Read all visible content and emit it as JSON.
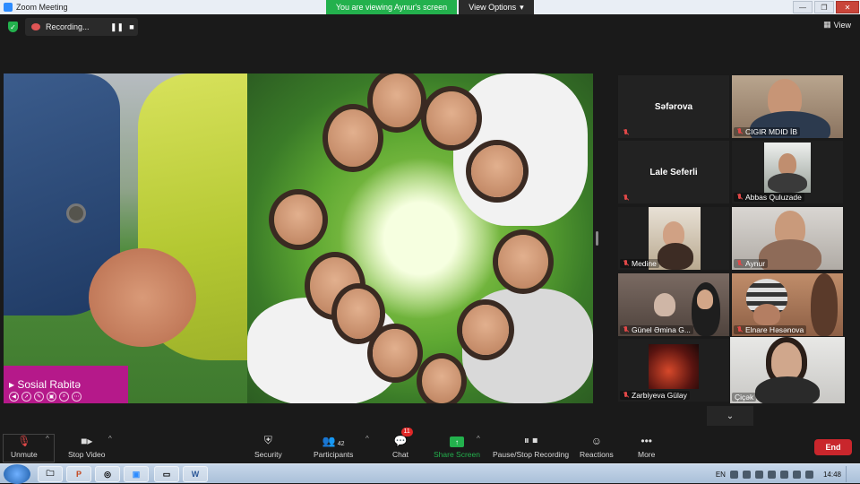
{
  "window": {
    "title": "Zoom Meeting"
  },
  "banner": {
    "viewing_text": "You are viewing Aynur's screen",
    "view_options": "View Options"
  },
  "recording": {
    "label": "Recording..."
  },
  "view_button": {
    "label": "View"
  },
  "slide": {
    "title": "Sosial Rabitə"
  },
  "gallery": {
    "tiles": [
      {
        "name": "Səfərova",
        "video": false,
        "muted": false
      },
      {
        "name": "CIGIR MDID İB",
        "video": true,
        "muted": true
      },
      {
        "name": "Lale Seferli",
        "video": false,
        "muted": false
      },
      {
        "name": "Abbas Quluzade",
        "video": true,
        "muted": true
      },
      {
        "name": "Medine",
        "video": true,
        "muted": true
      },
      {
        "name": "Aynur",
        "video": true,
        "muted": true
      },
      {
        "name": "Günel Əmina G...",
        "video": true,
        "muted": true
      },
      {
        "name": "Elnare Həsənova",
        "video": true,
        "muted": true
      },
      {
        "name": "Zarbiyeva Gülay",
        "video": true,
        "muted": true
      },
      {
        "name": "Çiçək",
        "video": true,
        "muted": false
      }
    ]
  },
  "toolbar": {
    "unmute": "Unmute",
    "stop_video": "Stop Video",
    "security": "Security",
    "participants": "Participants",
    "participants_count": "42",
    "chat": "Chat",
    "chat_badge": "11",
    "share_screen": "Share Screen",
    "pause_stop_recording": "Pause/Stop Recording",
    "reactions": "Reactions",
    "more": "More",
    "end": "End"
  },
  "taskbar": {
    "language": "EN",
    "time": "14:48"
  },
  "colors": {
    "share_green": "#23b14d",
    "end_red": "#c9262c",
    "slide_magenta": "#b5198a",
    "active_speaker": "#d8e04a"
  }
}
